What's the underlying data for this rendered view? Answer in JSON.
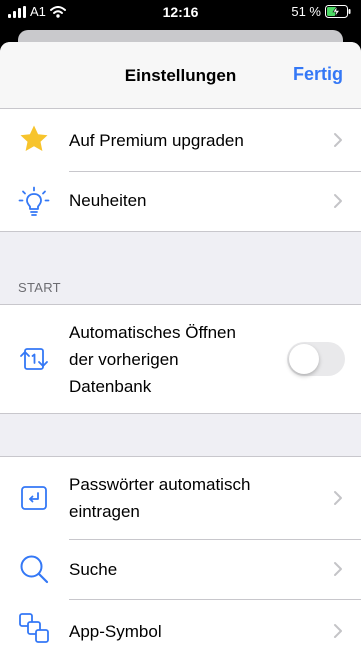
{
  "status_bar": {
    "carrier": "A1",
    "time": "12:16",
    "battery_text": "51 %",
    "battery_level": 0.51
  },
  "nav": {
    "title": "Einstellungen",
    "done_label": "Fertig"
  },
  "group_top": [
    {
      "label": "Auf Premium upgraden",
      "icon": "star-icon"
    },
    {
      "label": "Neuheiten",
      "icon": "lightbulb-icon"
    }
  ],
  "section_start": {
    "header": "START",
    "row": {
      "label": "Automatisches Öffnen der vorherigen Datenbank",
      "icon": "sync-database-icon",
      "toggle_on": false
    }
  },
  "group_bottom": [
    {
      "label": "Passwörter automatisch eintragen",
      "icon": "autofill-icon"
    },
    {
      "label": "Suche",
      "icon": "search-icon"
    },
    {
      "label": "App-Symbol",
      "icon": "app-icon"
    }
  ],
  "colors": {
    "accent": "#3478f6",
    "star": "#f7c42c",
    "background": "#efeff4"
  }
}
